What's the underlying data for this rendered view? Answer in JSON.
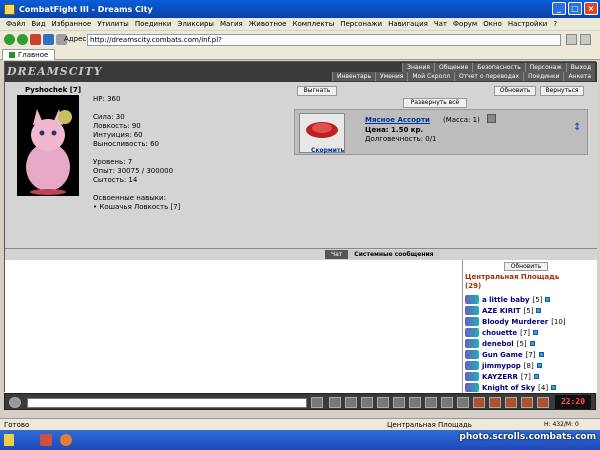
{
  "window": {
    "title": "CombatFight III - Dreams City"
  },
  "menu": [
    "Файл",
    "Вид",
    "Избранное",
    "Утилиты",
    "Поединки",
    "Эликсиры",
    "Магия",
    "Животное",
    "Комплекты",
    "Персонажи",
    "Навигация",
    "Чат",
    "Форум",
    "Окно",
    "Настройки",
    "?"
  ],
  "address": {
    "label": "Адрес:",
    "value": "http://dreamscity.combats.com/inf.pl?"
  },
  "tab": {
    "label": "Главное"
  },
  "game": {
    "logo": "DREAMSCITY",
    "nav_top": [
      "Знания",
      "Общение",
      "Безопасность",
      "Персонаж",
      "Выход"
    ],
    "nav_bottom": [
      "Инвентарь",
      "Умения",
      "Мой Скролл",
      "Отчет о переводах",
      "Поединки",
      "Анкета"
    ]
  },
  "character": {
    "name": "Pyshochek [7]",
    "hp": "HP: 360",
    "strength": "Сила: 30",
    "agility": "Ловкость: 90",
    "intuition": "Интуиция: 60",
    "endurance": "Выносливость: 60",
    "level": "Уровень: 7",
    "experience": "Опыт: 30075 / 300000",
    "satiety": "Сытость: 14",
    "skills_title": "Освоенные навыки:",
    "skill_1": "• Кошачья Ловкость [7]"
  },
  "buttons": {
    "kick": "Выгнать",
    "refresh": "Обновить",
    "back": "Вернуться",
    "expand": "Развернуть всё"
  },
  "item": {
    "name": "Мясное Ассорти",
    "mass": "(Масса: 1)",
    "price": "Цена: 1.50 кр.",
    "durability": "Долговечность: 0/1",
    "feed": "Скормить"
  },
  "chat": {
    "tab_chat": "Чат",
    "tab_system": "Системные сообщения"
  },
  "online": {
    "refresh": "Обновить",
    "location": "Центральная Площадь",
    "count": "(29)",
    "users": [
      {
        "name": "a little baby",
        "level": "[5]"
      },
      {
        "name": "AZE KIRIT",
        "level": "[5]"
      },
      {
        "name": "Bloody Murderer",
        "level": "[10]"
      },
      {
        "name": "chouette",
        "level": "[7]"
      },
      {
        "name": "denebol",
        "level": "[5]"
      },
      {
        "name": "Gun Game",
        "level": "[7]"
      },
      {
        "name": "jimmypop",
        "level": "[8]"
      },
      {
        "name": "KAYZERR",
        "level": "[7]"
      },
      {
        "name": "Knight of Sky",
        "level": "[4]"
      }
    ]
  },
  "clock": "22:20",
  "status": {
    "left": "Готово",
    "mid": "Центральная Площадь",
    "right": "H: 432/M: 0"
  },
  "watermark": "photo.scrolls.combats.com"
}
